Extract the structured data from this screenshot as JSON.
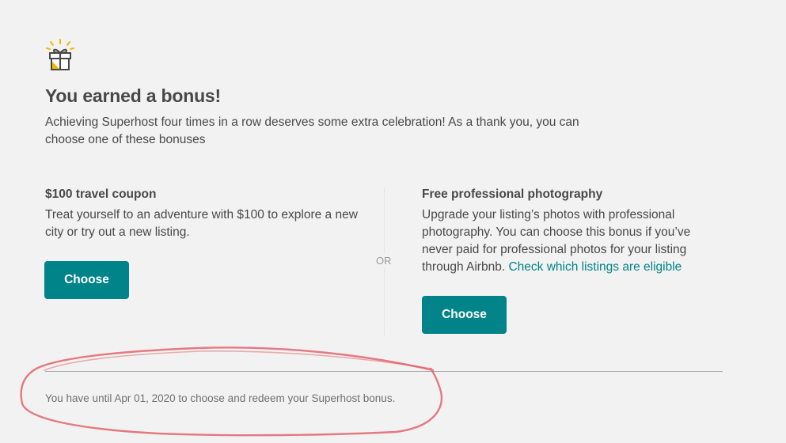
{
  "bonus": {
    "title": "You earned a bonus!",
    "subtitle": "Achieving Superhost four times in a row deserves some extra celebration! As a thank you, you can choose one of these bonuses",
    "or_label": "OR",
    "icon": "gift-icon"
  },
  "options": [
    {
      "title": "$100 travel coupon",
      "description": "Treat yourself to an adventure with $100 to explore a new city or try out a new listing.",
      "button_label": "Choose"
    },
    {
      "title": "Free professional photography",
      "description": "Upgrade your listing’s photos with professional photography. You can choose this bonus if you’ve never paid for professional photos for your listing through Airbnb.",
      "link_text": "Check which listings are eligible",
      "button_label": "Choose"
    }
  ],
  "footer": {
    "deadline_text": "You have until Apr 01, 2020 to choose and redeem your Superhost bonus."
  },
  "colors": {
    "accent": "#008489",
    "background": "#f2f2f2",
    "text": "#484848",
    "annotation": "#e0505a"
  }
}
